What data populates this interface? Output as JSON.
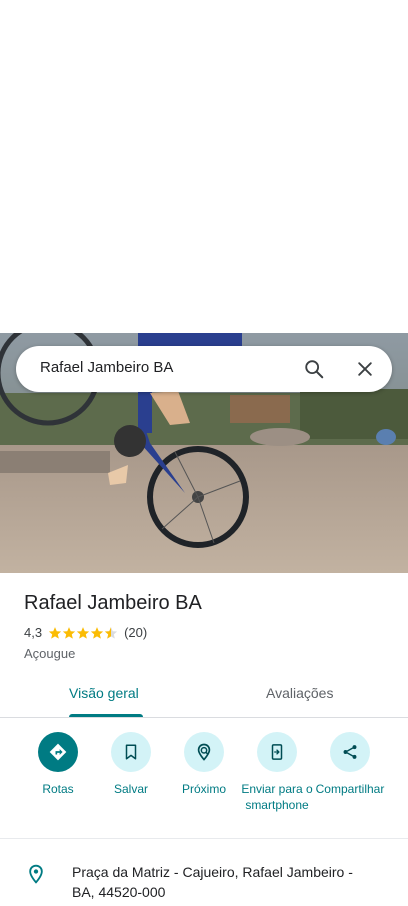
{
  "search": {
    "query": "Rafael Jambeiro BA"
  },
  "place": {
    "name": "Rafael Jambeiro BA",
    "rating": "4,3",
    "rating_value": 4.3,
    "review_count": "(20)",
    "category": "Açougue"
  },
  "tabs": [
    {
      "label": "Visão geral",
      "selected": true
    },
    {
      "label": "Avaliações",
      "selected": false
    }
  ],
  "actions": [
    {
      "label": "Rotas",
      "icon": "directions-icon"
    },
    {
      "label": "Salvar",
      "icon": "bookmark-icon"
    },
    {
      "label": "Próximo",
      "icon": "nearby-icon"
    },
    {
      "label": "Enviar para o smartphone",
      "icon": "send-to-phone-icon"
    },
    {
      "label": "Compartilhar",
      "icon": "share-icon"
    }
  ],
  "address": {
    "text": "Praça da Matriz - Cajueiro, Rafael Jambeiro - BA, 44520-000"
  },
  "colors": {
    "accent": "#007b83",
    "accent_light": "#d3f3f7",
    "star": "#fbbc04"
  }
}
